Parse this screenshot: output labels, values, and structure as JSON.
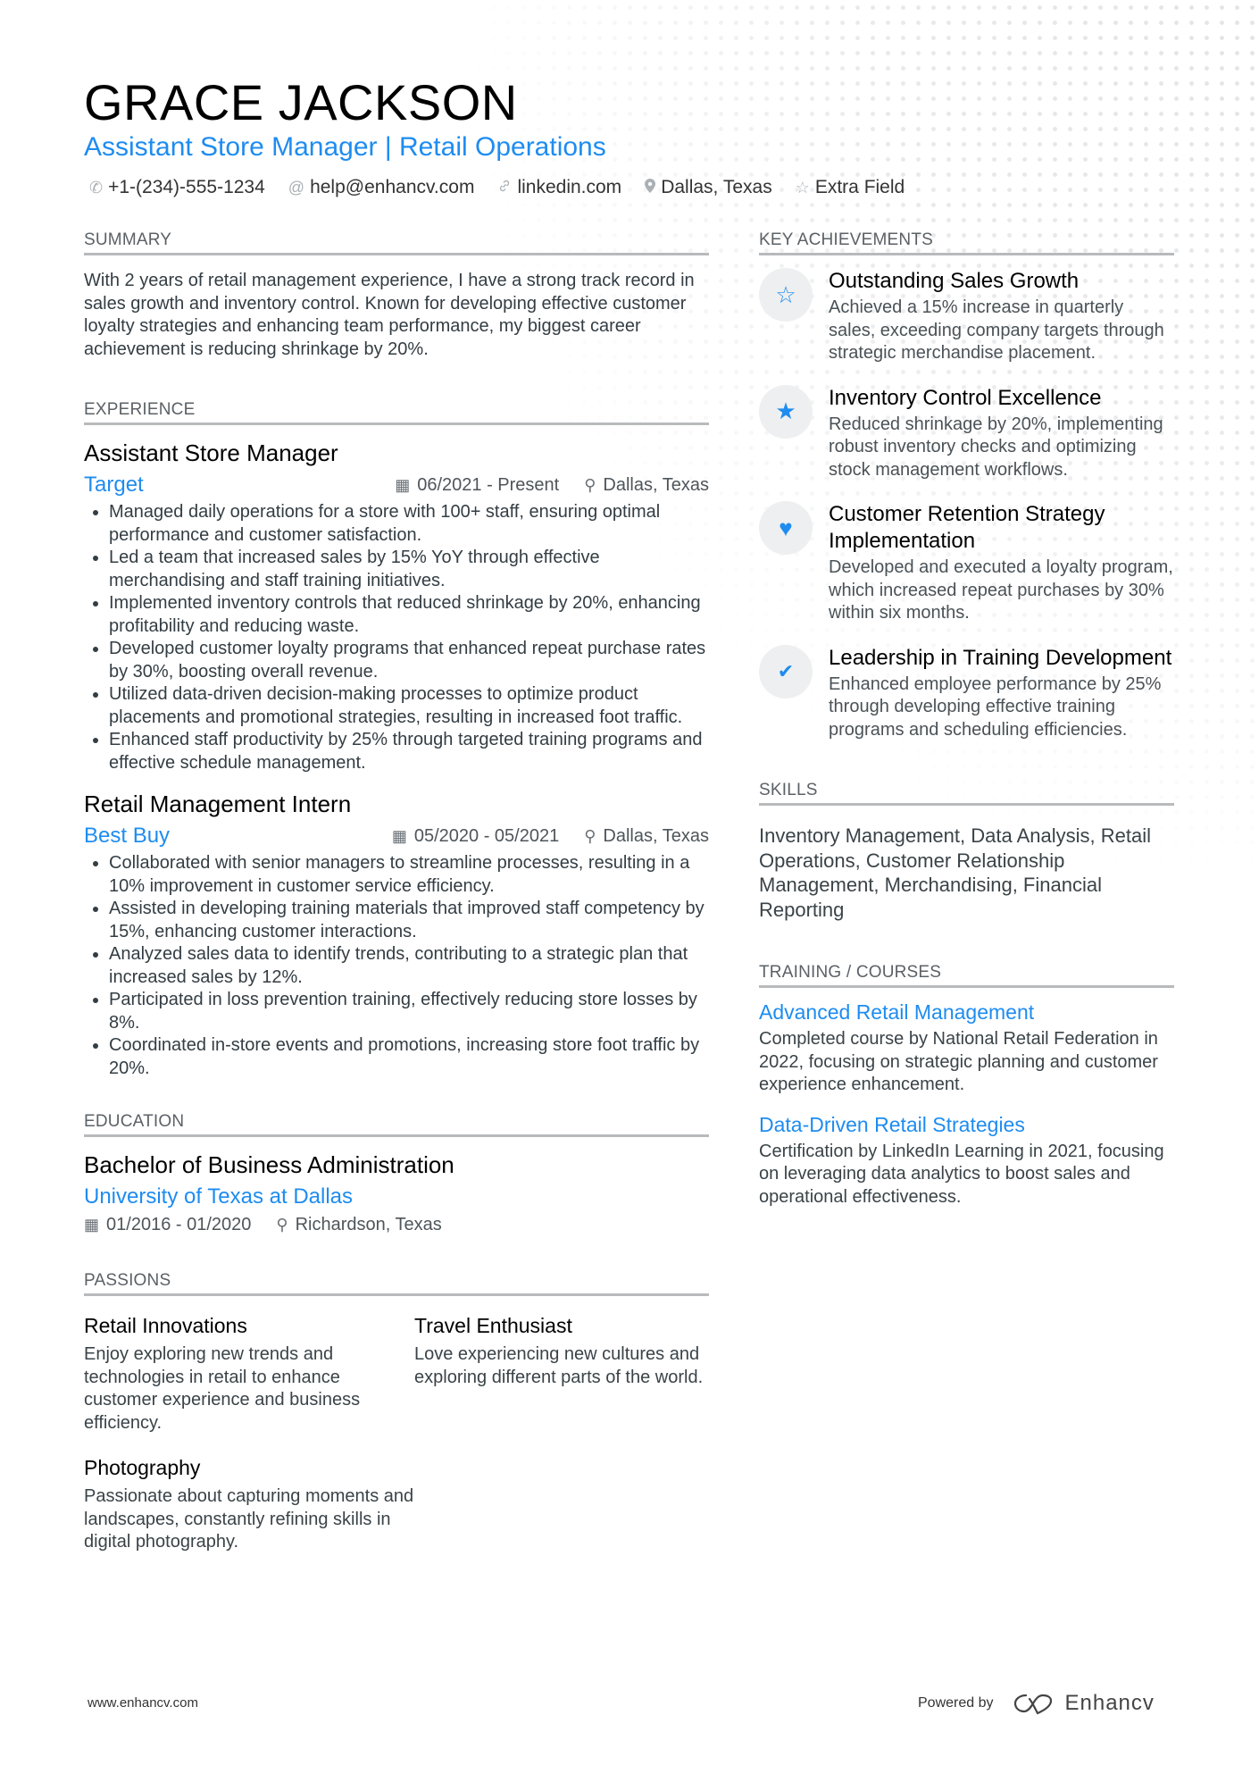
{
  "header": {
    "name": "GRACE JACKSON",
    "title": "Assistant Store Manager | Retail Operations",
    "contacts": [
      {
        "icon": "phone-icon",
        "glyph": "✆",
        "text": "+1-(234)-555-1234"
      },
      {
        "icon": "at-icon",
        "glyph": "@",
        "text": "help@enhancv.com"
      },
      {
        "icon": "link-icon",
        "glyph": "🔗",
        "text": "linkedin.com"
      },
      {
        "icon": "location-icon",
        "glyph": "⚲",
        "text": "Dallas, Texas"
      },
      {
        "icon": "star-icon",
        "glyph": "☆",
        "text": "Extra Field"
      }
    ]
  },
  "summary": {
    "heading": "SUMMARY",
    "text": "With 2 years of retail management experience, I have a strong track record in sales growth and inventory control. Known for developing effective customer loyalty strategies and enhancing team performance, my biggest career achievement is reducing shrinkage by 20%."
  },
  "experience": {
    "heading": "EXPERIENCE",
    "items": [
      {
        "role": "Assistant Store Manager",
        "company": "Target",
        "dates": "06/2021 - Present",
        "location": "Dallas, Texas",
        "bullets": [
          "Managed daily operations for a store with 100+ staff, ensuring optimal performance and customer satisfaction.",
          "Led a team that increased sales by 15% YoY through effective merchandising and staff training initiatives.",
          "Implemented inventory controls that reduced shrinkage by 20%, enhancing profitability and reducing waste.",
          "Developed customer loyalty programs that enhanced repeat purchase rates by 30%, boosting overall revenue.",
          "Utilized data-driven decision-making processes to optimize product placements and promotional strategies, resulting in increased foot traffic.",
          "Enhanced staff productivity by 25% through targeted training programs and effective schedule management."
        ]
      },
      {
        "role": "Retail Management Intern",
        "company": "Best Buy",
        "dates": "05/2020 - 05/2021",
        "location": "Dallas, Texas",
        "bullets": [
          "Collaborated with senior managers to streamline processes, resulting in a 10% improvement in customer service efficiency.",
          "Assisted in developing training materials that improved staff competency by 15%, enhancing customer interactions.",
          "Analyzed sales data to identify trends, contributing to a strategic plan that increased sales by 12%.",
          "Participated in loss prevention training, effectively reducing store losses by 8%.",
          "Coordinated in-store events and promotions, increasing store foot traffic by 20%."
        ]
      }
    ]
  },
  "education": {
    "heading": "EDUCATION",
    "degree": "Bachelor of Business Administration",
    "school": "University of Texas at Dallas",
    "dates": "01/2016 - 01/2020",
    "location": "Richardson, Texas"
  },
  "passions": {
    "heading": "PASSIONS",
    "items": [
      {
        "title": "Retail Innovations",
        "desc": "Enjoy exploring new trends and technologies in retail to enhance customer experience and business efficiency."
      },
      {
        "title": "Travel Enthusiast",
        "desc": "Love experiencing new cultures and exploring different parts of the world."
      },
      {
        "title": "Photography",
        "desc": "Passionate about capturing moments and landscapes, constantly refining skills in digital photography."
      }
    ]
  },
  "achievements": {
    "heading": "KEY ACHIEVEMENTS",
    "items": [
      {
        "icon": "star-outline-icon",
        "glyph": "☆",
        "title": "Outstanding Sales Growth",
        "desc": "Achieved a 15% increase in quarterly sales, exceeding company targets through strategic merchandise placement."
      },
      {
        "icon": "star-filled-icon",
        "glyph": "★",
        "title": "Inventory Control Excellence",
        "desc": "Reduced shrinkage by 20%, implementing robust inventory checks and optimizing stock management workflows."
      },
      {
        "icon": "heart-icon",
        "glyph": "♥",
        "title": "Customer Retention Strategy Implementation",
        "desc": "Developed and executed a loyalty program, which increased repeat purchases by 30% within six months."
      },
      {
        "icon": "check-icon",
        "glyph": "✔",
        "title": "Leadership in Training Development",
        "desc": "Enhanced employee performance by 25% through developing effective training programs and scheduling efficiencies."
      }
    ]
  },
  "skills": {
    "heading": "SKILLS",
    "text": "Inventory Management, Data Analysis, Retail Operations, Customer Relationship Management, Merchandising, Financial Reporting"
  },
  "training": {
    "heading": "TRAINING / COURSES",
    "items": [
      {
        "title": "Advanced Retail Management",
        "desc": "Completed course by National Retail Federation in 2022, focusing on strategic planning and customer experience enhancement."
      },
      {
        "title": "Data-Driven Retail Strategies",
        "desc": "Certification by LinkedIn Learning in 2021, focusing on leveraging data analytics to boost sales and operational effectiveness."
      }
    ]
  },
  "footer": {
    "website": "www.enhancv.com",
    "powered_by": "Powered by",
    "brand": "Enhancv"
  },
  "colors": {
    "accent": "#1e8cf0",
    "rule": "#b8babc",
    "icon_bg": "#eeeff0"
  }
}
